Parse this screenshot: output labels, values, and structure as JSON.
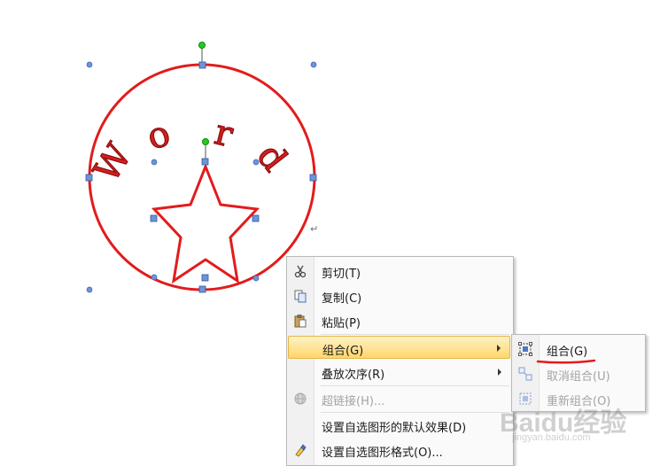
{
  "canvas": {
    "wordart_letters": [
      "W",
      "o",
      "r",
      "d"
    ],
    "shape_color": "#e31b1b",
    "handle_color": "#4a7fd0",
    "rotate_handle_color": "#22cc22"
  },
  "context_menu": {
    "items": [
      {
        "label": "剪切(T)",
        "icon": "scissors-icon",
        "enabled": true
      },
      {
        "label": "复制(C)",
        "icon": "copy-icon",
        "enabled": true
      },
      {
        "label": "粘贴(P)",
        "icon": "paste-icon",
        "enabled": true
      },
      {
        "label": "组合(G)",
        "icon": "",
        "enabled": true,
        "submenu": true,
        "highlighted": true
      },
      {
        "label": "叠放次序(R)",
        "icon": "",
        "enabled": true,
        "submenu": true
      },
      {
        "label": "超链接(H)...",
        "icon": "hyperlink-icon",
        "enabled": false
      },
      {
        "label": "设置自选图形的默认效果(D)",
        "icon": "",
        "enabled": true
      },
      {
        "label": "设置自选图形格式(O)...",
        "icon": "format-shape-icon",
        "enabled": true
      }
    ],
    "highlight_color": "#ffd66b"
  },
  "submenu": {
    "items": [
      {
        "label": "组合(G)",
        "icon": "group-icon",
        "enabled": true
      },
      {
        "label": "取消组合(U)",
        "icon": "ungroup-icon",
        "enabled": false
      },
      {
        "label": "重新组合(O)",
        "icon": "regroup-icon",
        "enabled": false
      }
    ]
  },
  "watermark": {
    "text": "Baidu经验",
    "url": "jingyan.baidu.com"
  }
}
